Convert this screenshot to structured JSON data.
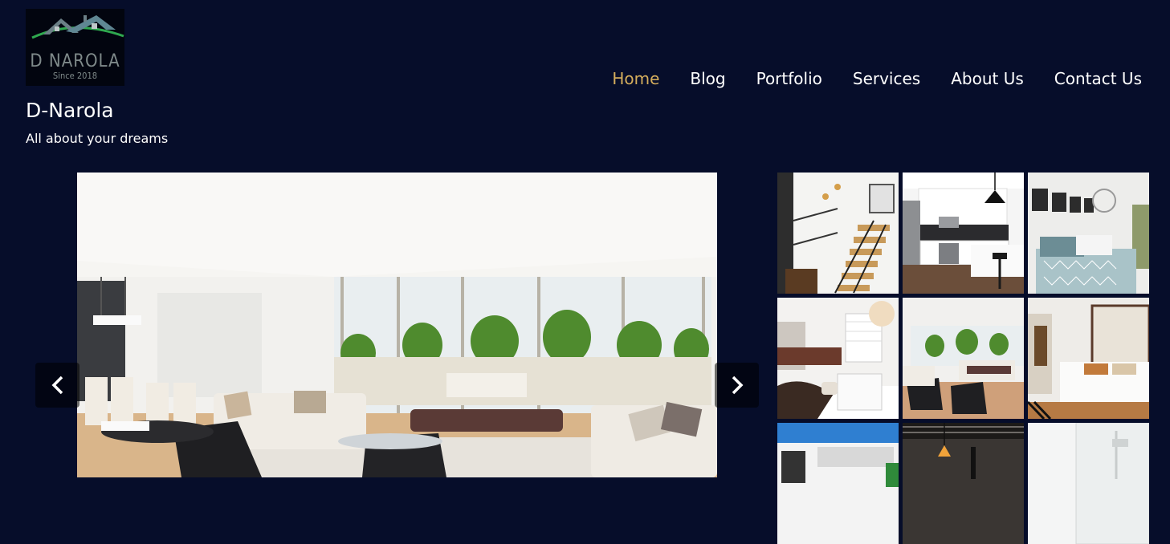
{
  "logo": {
    "name": "D NAROLA",
    "since": "Since 2018",
    "icon": "house-roof-logo-icon"
  },
  "site": {
    "title": "D-Narola",
    "tagline": "All about your dreams"
  },
  "nav": {
    "items": [
      {
        "label": "Home",
        "active": true
      },
      {
        "label": "Blog"
      },
      {
        "label": "Portfolio"
      },
      {
        "label": "Services"
      },
      {
        "label": "About Us"
      },
      {
        "label": "Contact Us"
      }
    ]
  },
  "colors": {
    "background": "#060d2a",
    "accent": "#d4ad5c",
    "text": "#ffffff"
  },
  "carousel": {
    "prev_icon": "chevron-left-icon",
    "next_icon": "chevron-right-icon"
  },
  "gallery": {
    "thumbnails": [
      "staircase",
      "kitchen",
      "bedroom",
      "bathroom",
      "living-room",
      "master-bedroom",
      "house-exterior",
      "dark-hallway",
      "shower"
    ]
  }
}
